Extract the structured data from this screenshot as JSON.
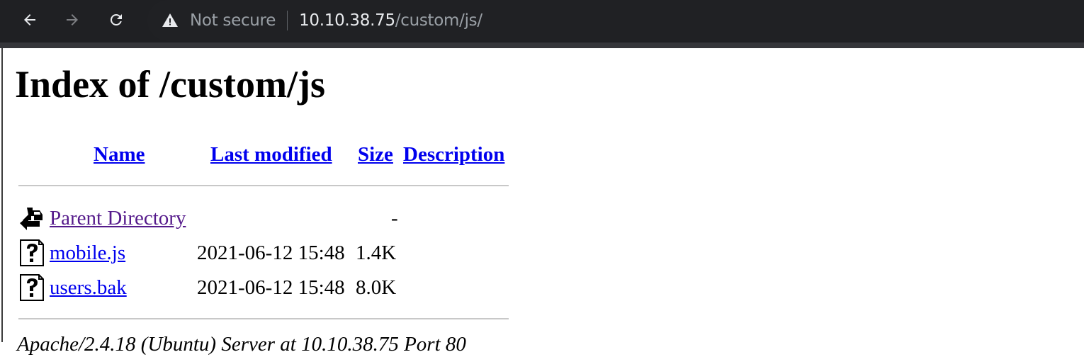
{
  "browser": {
    "security_label": "Not secure",
    "url_host": "10.10.38.75",
    "url_path": "/custom/js/"
  },
  "page": {
    "title": "Index of /custom/js",
    "headers": {
      "name": "Name",
      "last_modified": "Last modified",
      "size": "Size",
      "description": "Description"
    },
    "rows": [
      {
        "icon": "back-icon",
        "name": "Parent Directory",
        "modified": "",
        "size": "-",
        "visited": true
      },
      {
        "icon": "unknown-file-icon",
        "name": "mobile.js",
        "modified": "2021-06-12 15:48",
        "size": "1.4K",
        "visited": false
      },
      {
        "icon": "unknown-file-icon",
        "name": "users.bak",
        "modified": "2021-06-12 15:48",
        "size": "8.0K",
        "visited": false
      }
    ],
    "footer": "Apache/2.4.18 (Ubuntu) Server at 10.10.38.75 Port 80"
  }
}
